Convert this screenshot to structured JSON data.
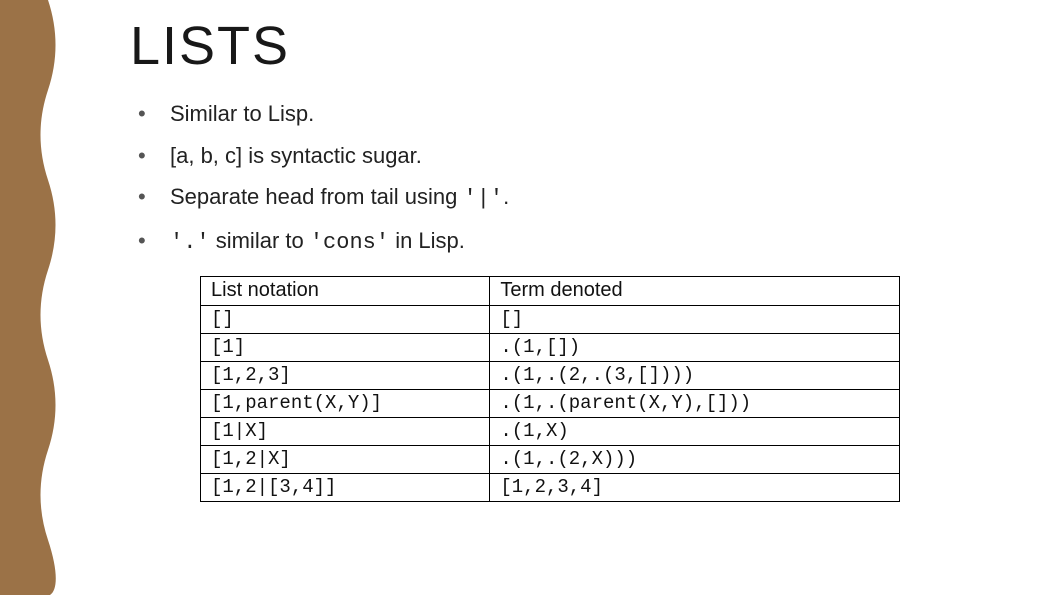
{
  "title": "LISTS",
  "bullets": {
    "b1": "Similar to Lisp.",
    "b2": "[a, b, c] is syntactic sugar.",
    "b3_pre": "Separate head from tail using ",
    "b3_code": "'|'",
    "b3_post": ".",
    "b4_code1": "'.'",
    "b4_mid": " similar to ",
    "b4_code2": "'cons'",
    "b4_post": " in Lisp."
  },
  "table": {
    "header": {
      "col1": "List notation",
      "col2": "Term denoted"
    },
    "rows": [
      {
        "c1": "[]",
        "c2": "[]"
      },
      {
        "c1": "[1]",
        "c2": ".(1,[])"
      },
      {
        "c1": "[1,2,3]",
        "c2": ".(1,.(2,.(3,[])))"
      },
      {
        "c1": "[1,parent(X,Y)]",
        "c2": ".(1,.(parent(X,Y),[]))"
      },
      {
        "c1": "[1|X]",
        "c2": ".(1,X)"
      },
      {
        "c1": "[1,2|X]",
        "c2": ".(1,.(2,X)))"
      },
      {
        "c1": "[1,2|[3,4]]",
        "c2": "[1,2,3,4]"
      }
    ]
  },
  "chart_data": {
    "type": "table",
    "title": "LISTS",
    "columns": [
      "List notation",
      "Term denoted"
    ],
    "rows": [
      [
        "[]",
        "[]"
      ],
      [
        "[1]",
        ".(1,[])"
      ],
      [
        "[1,2,3]",
        ".(1,.(2,.(3,[])))"
      ],
      [
        "[1,parent(X,Y)]",
        ".(1,.(parent(X,Y),[]))"
      ],
      [
        "[1|X]",
        ".(1,X)"
      ],
      [
        "[1,2|X]",
        ".(1,.(2,X)))"
      ],
      [
        "[1,2|[3,4]]",
        "[1,2,3,4]"
      ]
    ]
  }
}
